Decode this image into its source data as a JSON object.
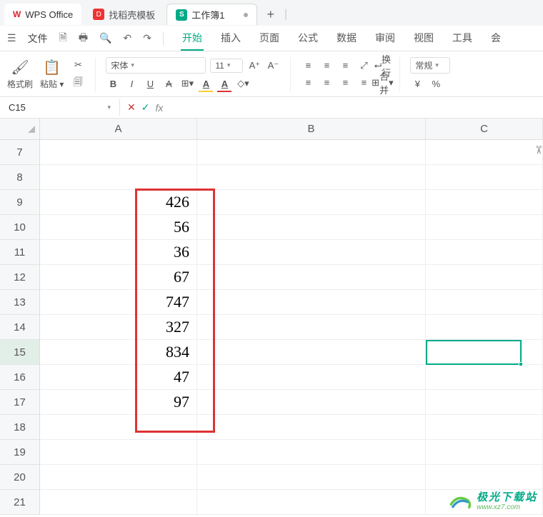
{
  "tabs": {
    "app_label": "WPS Office",
    "docer_label": "找稻壳模板",
    "sheet_label": "工作簿1",
    "sheet_badge": "S",
    "add": "+"
  },
  "menu": {
    "file": "文件",
    "ribbon": [
      "开始",
      "插入",
      "页面",
      "公式",
      "数据",
      "审阅",
      "视图",
      "工具",
      "会"
    ]
  },
  "toolbar": {
    "format_painter": "格式刷",
    "paste": "粘贴",
    "font_name": "宋体",
    "font_size": "11",
    "wrap": "换行",
    "merge": "合并",
    "number_format": "常规",
    "currency": "¥",
    "percent": "%"
  },
  "formula": {
    "namebox": "C15",
    "fx_label": "fx",
    "value": ""
  },
  "grid": {
    "columns": [
      "A",
      "B",
      "C"
    ],
    "row_start": 7,
    "row_count": 15,
    "active_row": 15,
    "active_col": "C",
    "data_col": "A",
    "values": {
      "9": "426",
      "10": "56",
      "11": "36",
      "12": "67",
      "13": "747",
      "14": "327",
      "15": "834",
      "16": "47",
      "17": "97"
    }
  },
  "watermark": {
    "cn": "极光下载站",
    "url": "www.xz7.com"
  }
}
